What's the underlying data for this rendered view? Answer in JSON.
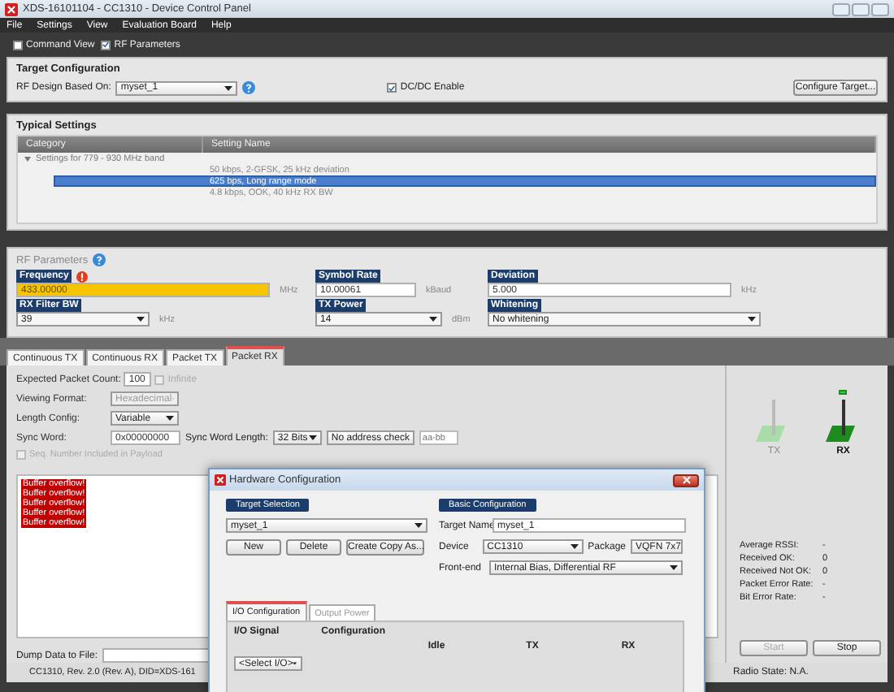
{
  "window": {
    "title": "XDS-16101104 - CC1310 - Device Control Panel"
  },
  "menu": [
    "File",
    "Settings",
    "View",
    "Evaluation Board",
    "Help"
  ],
  "view_options": [
    {
      "label": "Command View",
      "checked": false
    },
    {
      "label": "RF Parameters",
      "checked": true
    }
  ],
  "target_configuration": {
    "title": "Target Configuration",
    "design_label": "RF Design Based On:",
    "design_value": "myset_1",
    "dcdc": {
      "label": "DC/DC Enable",
      "checked": true
    },
    "configure_button": "Configure Target..."
  },
  "typical_settings": {
    "title": "Typical Settings",
    "columns": [
      "Category",
      "Setting Name"
    ],
    "groups": [
      {
        "label": "Settings for 779 - 930 MHz band",
        "expanded": true,
        "children": [
          {
            "label": "50 kbps, 2-GFSK, 25 kHz deviation",
            "selected": false
          },
          {
            "label": "625 bps, Long range mode",
            "selected": true
          },
          {
            "label": "4.8 kbps, OOK, 40 kHz RX BW",
            "selected": false
          }
        ]
      }
    ]
  },
  "rf_parameters": {
    "title": "RF Parameters",
    "fields": [
      {
        "kind": "input",
        "label": "Frequency",
        "value": "433.00000",
        "unit": "MHz",
        "error": true
      },
      {
        "kind": "input",
        "label": "Symbol Rate",
        "value": "10.00061",
        "unit": "kBaud",
        "error": false
      },
      {
        "kind": "input",
        "label": "Deviation",
        "value": "5.000",
        "unit": "kHz",
        "error": false
      },
      {
        "kind": "select",
        "label": "RX Filter BW",
        "value": "39",
        "unit": "kHz",
        "error": false
      },
      {
        "kind": "select",
        "label": "TX Power",
        "value": "14",
        "unit": "dBm",
        "error": false
      },
      {
        "kind": "select",
        "label": "Whitening",
        "value": "No whitening",
        "error": false
      }
    ]
  },
  "tabs": [
    {
      "label": "Continuous TX",
      "selected": false
    },
    {
      "label": "Continuous RX",
      "selected": false
    },
    {
      "label": "Packet TX",
      "selected": false
    },
    {
      "label": "Packet RX",
      "selected": true
    }
  ],
  "packet_rx": {
    "expected_count": {
      "label": "Expected Packet Count:",
      "value": "100"
    },
    "infinite": {
      "label": "Infinite",
      "checked": false,
      "disabled": true
    },
    "viewing_format": {
      "label": "Viewing Format:",
      "value": "Hexadecimal",
      "disabled": true
    },
    "length_config": {
      "label": "Length Config:",
      "value": "Variable",
      "disabled": false
    },
    "sync_word": {
      "label": "Sync Word:",
      "value": "0x00000000"
    },
    "sync_word_length": {
      "label": "Sync Word Length:",
      "value": "32 Bits",
      "disabled": false
    },
    "address_check": {
      "value": "No address check",
      "disabled": false
    },
    "address": {
      "placeholder": "aa-bb"
    },
    "seq_number": {
      "label": "Seq. Number Included in Payload",
      "checked": false,
      "disabled": true
    },
    "log": [
      "Buffer overflow!",
      "Buffer overflow!",
      "Buffer overflow!",
      "Buffer overflow!",
      "Buffer overflow!"
    ],
    "dump_label": "Dump Data to File:"
  },
  "radio": [
    {
      "label": "TX",
      "active": false
    },
    {
      "label": "RX",
      "active": true
    }
  ],
  "statistics": [
    {
      "label": "Average RSSI:",
      "value": "-"
    },
    {
      "label": "Received OK:",
      "value": "0"
    },
    {
      "label": "Received Not OK:",
      "value": "0"
    },
    {
      "label": "Packet Error Rate:",
      "value": "-"
    },
    {
      "label": "Bit Error Rate:",
      "value": "-"
    }
  ],
  "buttons": [
    {
      "label": "Start",
      "disabled": true
    },
    {
      "label": "Stop",
      "disabled": false
    }
  ],
  "status_bar": {
    "device": "CC1310, Rev. 2.0 (Rev. A), DID=XDS-161",
    "radio_state": "Radio State: N.A."
  },
  "dialog": {
    "title": "Hardware Configuration",
    "target_selection": {
      "title": "Target Selection",
      "value": "myset_1",
      "buttons": [
        "New",
        "Delete",
        "Create Copy As..."
      ]
    },
    "basic_configuration": {
      "title": "Basic Configuration",
      "target_name": {
        "label": "Target Name",
        "value": "myset_1"
      },
      "device": {
        "label": "Device",
        "value": "CC1310"
      },
      "package": {
        "label": "Package",
        "value": "VQFN 7x7"
      },
      "front_end": {
        "label": "Front-end",
        "value": "Internal Bias, Differential RF"
      }
    },
    "tabs": [
      {
        "label": "I/O Configuration",
        "selected": true
      },
      {
        "label": "Output Power",
        "selected": false
      }
    ],
    "columns": [
      "I/O Signal",
      "Configuration"
    ],
    "subcolumns": [
      "Idle",
      "TX",
      "RX"
    ],
    "io_select": "<Select I/O>"
  }
}
